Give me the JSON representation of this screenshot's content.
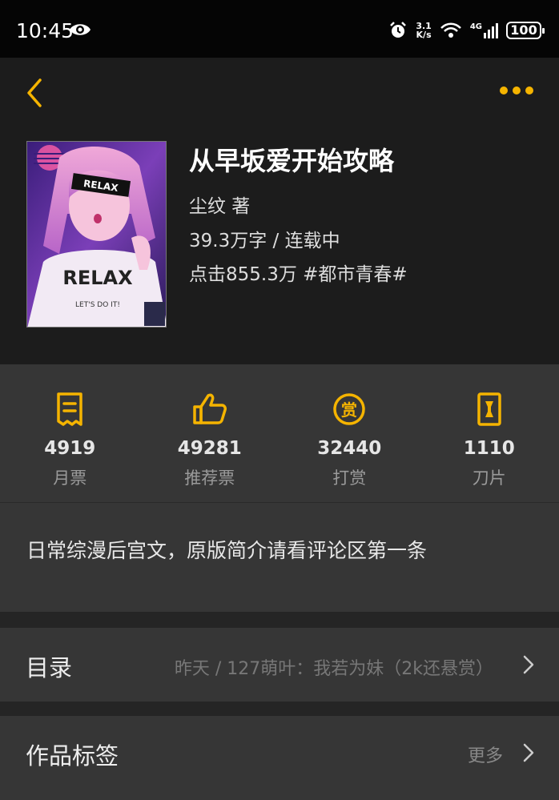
{
  "status_bar": {
    "time": "10:45",
    "net_speed_value": "3.1",
    "net_speed_unit": "K/s",
    "network_type": "4G",
    "battery": "100"
  },
  "header": {
    "back_icon": "chevron-left-icon",
    "more_icon": "more-horizontal-icon",
    "accent_color": "#f5b400"
  },
  "book": {
    "title": "从早坂爱开始攻略",
    "author": "尘纹  著",
    "meta": "39.3万字 / 连载中",
    "stats": "点击855.3万  #都市青春#",
    "cover_text_top": "RELAX",
    "cover_text_shirt": "RELAX",
    "cover_text_sub": "LET'S DO IT!"
  },
  "tickets": [
    {
      "icon": "monthly-ticket-icon",
      "count": "4919",
      "label": "月票"
    },
    {
      "icon": "thumbs-up-icon",
      "count": "49281",
      "label": "推荐票"
    },
    {
      "icon": "reward-coin-icon",
      "count": "32440",
      "label": "打赏"
    },
    {
      "icon": "blade-icon",
      "count": "1110",
      "label": "刀片"
    }
  ],
  "synopsis": "日常综漫后宫文，原版简介请看评论区第一条",
  "catalog": {
    "title": "目录",
    "latest": "昨天 / 127萌叶：我若为妹（2k还悬赏）"
  },
  "tags": {
    "title": "作品标签",
    "more": "更多"
  }
}
